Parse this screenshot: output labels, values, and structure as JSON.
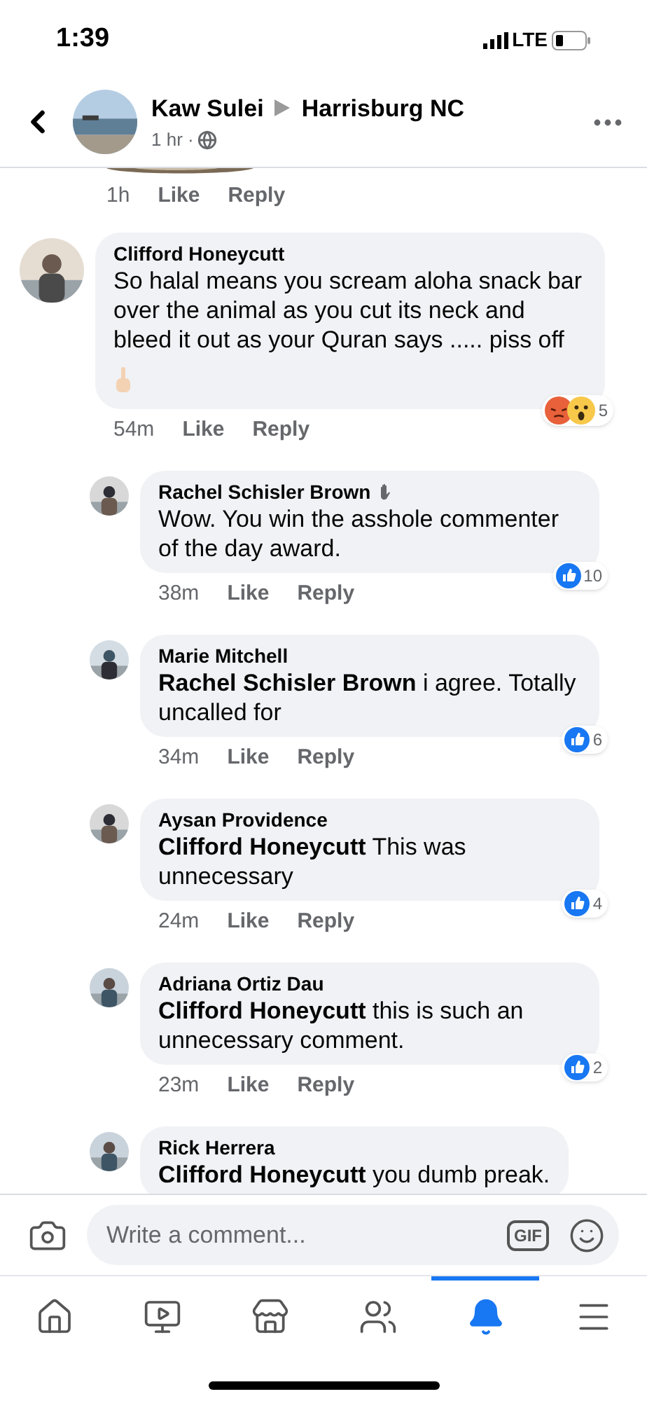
{
  "status_bar": {
    "time": "1:39",
    "network": "LTE"
  },
  "header": {
    "author": "Kaw Sulei",
    "target": "Harrisburg NC",
    "time": "1 hr ·"
  },
  "previous_comment": {
    "time": "1h",
    "like": "Like",
    "reply": "Reply"
  },
  "comments": [
    {
      "kind": "comment",
      "author": "Clifford Honeycutt",
      "wave_badge": false,
      "text": "So halal means you scream aloha snack bar over the animal as you cut its neck and bleed it out as your Quran says ..... piss off",
      "gesture_emoji": true,
      "time": "54m",
      "like": "Like",
      "reply": "Reply",
      "reactions": [
        {
          "kind": "angry"
        },
        {
          "kind": "wow"
        }
      ],
      "reaction_count": "5"
    },
    {
      "kind": "reply",
      "author": "Rachel Schisler Brown",
      "wave_badge": true,
      "text": "Wow. You win the asshole commenter of the day award.",
      "gesture_emoji": false,
      "time": "38m",
      "like": "Like",
      "reply": "Reply",
      "reactions": [
        {
          "kind": "like"
        }
      ],
      "reaction_count": "10"
    },
    {
      "kind": "reply",
      "author": "Marie Mitchell",
      "wave_badge": false,
      "text": "**Rachel Schisler Brown** i agree. Totally uncalled for",
      "gesture_emoji": false,
      "time": "34m",
      "like": "Like",
      "reply": "Reply",
      "reactions": [
        {
          "kind": "like"
        }
      ],
      "reaction_count": "6"
    },
    {
      "kind": "reply",
      "author": "Aysan Providence",
      "wave_badge": false,
      "text": "**Clifford Honeycutt** This was unnecessary",
      "gesture_emoji": false,
      "time": "24m",
      "like": "Like",
      "reply": "Reply",
      "reactions": [
        {
          "kind": "like"
        }
      ],
      "reaction_count": "4"
    },
    {
      "kind": "reply",
      "author": "Adriana Ortiz Dau",
      "wave_badge": false,
      "text": "**Clifford Honeycutt** this is such an unnecessary comment.",
      "gesture_emoji": false,
      "time": "23m",
      "like": "Like",
      "reply": "Reply",
      "reactions": [
        {
          "kind": "like"
        }
      ],
      "reaction_count": "2"
    },
    {
      "kind": "reply",
      "author": "Rick Herrera",
      "wave_badge": false,
      "text": "**Clifford Honeycutt** you dumb preak.",
      "gesture_emoji": false
    }
  ],
  "composer": {
    "placeholder": "Write a comment...",
    "gif": "GIF"
  },
  "tabs": [
    {
      "kind": "home",
      "selected": false
    },
    {
      "kind": "watch",
      "selected": false
    },
    {
      "kind": "marketplace",
      "selected": false
    },
    {
      "kind": "groups",
      "selected": false
    },
    {
      "kind": "notifications",
      "selected": true
    },
    {
      "kind": "menu",
      "selected": false
    }
  ]
}
